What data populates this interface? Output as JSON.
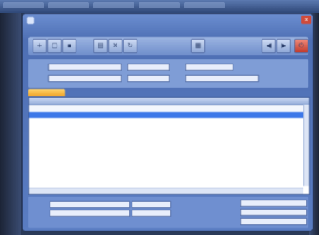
{
  "colors": {
    "window": "#5a7dc2",
    "selection": "#3d78e8",
    "tab_orange": "#f0a52a",
    "close": "#d04a3a"
  },
  "taskbar": {
    "tabs": [
      "",
      "",
      "",
      "",
      ""
    ]
  },
  "window": {
    "title": "",
    "close_glyph": "×"
  },
  "toolbar": {
    "left_icons": [
      "new-icon",
      "open-icon",
      "save-icon",
      "print-icon",
      "delete-icon",
      "refresh-icon"
    ],
    "center_icon": "calculator-icon",
    "right_icons": [
      "previous-icon",
      "next-icon",
      "exit-icon"
    ]
  },
  "form": {
    "field1": "",
    "field2": "",
    "field3": "",
    "field4": "",
    "field5": "",
    "field6": ""
  },
  "tab": {
    "label": ""
  },
  "grid": {
    "headers": [
      "",
      "",
      "",
      "",
      "",
      "",
      "",
      ""
    ],
    "rows": [
      [
        "",
        "",
        "",
        "",
        "",
        "",
        "",
        ""
      ],
      [
        "",
        "",
        "",
        "",
        "",
        "",
        "",
        ""
      ]
    ]
  },
  "bottom": {
    "field1": "",
    "field2": "",
    "field3": "",
    "field4": "",
    "field5": "",
    "field6": "",
    "field7": ""
  }
}
